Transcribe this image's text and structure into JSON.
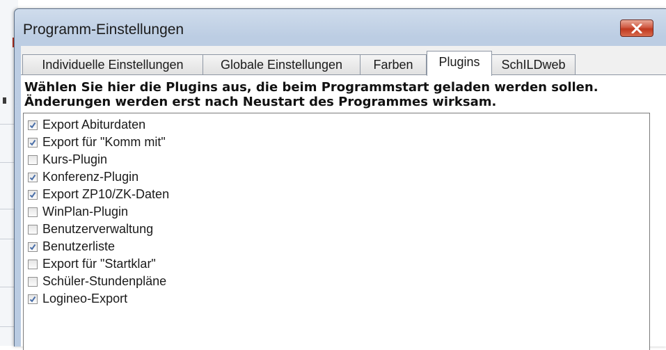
{
  "window": {
    "title": "Programm-Einstellungen"
  },
  "tabs": [
    {
      "label": "Individuelle Einstellungen",
      "active": false
    },
    {
      "label": "Globale Einstellungen",
      "active": false
    },
    {
      "label": "Farben",
      "active": false
    },
    {
      "label": "Plugins",
      "active": true
    },
    {
      "label": "SchILDweb",
      "active": false
    }
  ],
  "plugins_page": {
    "hint_line1": "Wählen Sie hier die Plugins aus, die beim Programmstart geladen werden sollen.",
    "hint_line2": "Änderungen werden erst nach Neustart des Programmes wirksam.",
    "items": [
      {
        "label": "Export Abiturdaten",
        "checked": true
      },
      {
        "label": "Export für \"Komm mit\"",
        "checked": true
      },
      {
        "label": "Kurs-Plugin",
        "checked": false
      },
      {
        "label": "Konferenz-Plugin",
        "checked": true
      },
      {
        "label": "Export ZP10/ZK-Daten",
        "checked": true
      },
      {
        "label": "WinPlan-Plugin",
        "checked": false
      },
      {
        "label": "Benutzerverwaltung",
        "checked": false
      },
      {
        "label": "Benutzerliste",
        "checked": true
      },
      {
        "label": "Export für \"Startklar\"",
        "checked": false
      },
      {
        "label": "Schüler-Stundenpläne",
        "checked": false
      },
      {
        "label": "Logineo-Export",
        "checked": true
      }
    ]
  },
  "colors": {
    "title_bar": "#bccde3",
    "close_button": "#c0391f",
    "check_mark": "#4a6fa8"
  },
  "icons": {
    "close": "close-icon",
    "check": "check-icon"
  }
}
